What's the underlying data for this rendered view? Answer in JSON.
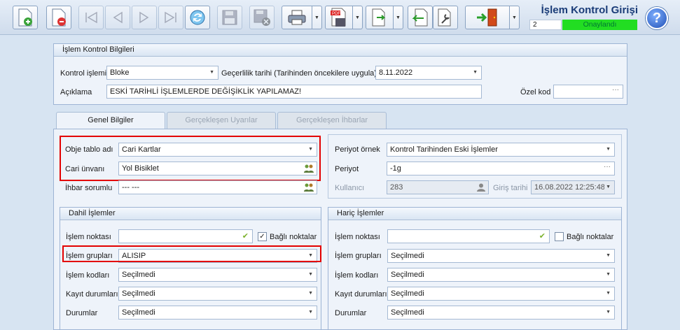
{
  "window": {
    "title": "İşlem Kontrol Girişi",
    "status_number": "2",
    "status_text": "Onaylandı"
  },
  "colors": {
    "status_ok": "#22dd22",
    "highlight": "#e30000",
    "title": "#1a3c78"
  },
  "toolbar": [
    {
      "name": "new-icon",
      "enabled": true
    },
    {
      "name": "delete-icon",
      "enabled": true
    },
    {
      "name": "first-icon",
      "enabled": false
    },
    {
      "name": "prev-icon",
      "enabled": false
    },
    {
      "name": "next-icon",
      "enabled": false
    },
    {
      "name": "last-icon",
      "enabled": false
    },
    {
      "name": "refresh-icon",
      "enabled": true
    },
    {
      "name": "save-icon",
      "enabled": false
    },
    {
      "name": "save-close-icon",
      "enabled": false
    },
    {
      "name": "print-icon",
      "enabled": true
    },
    {
      "name": "pdf-icon",
      "enabled": true
    },
    {
      "name": "export-icon",
      "enabled": true
    },
    {
      "name": "import-icon",
      "enabled": true
    },
    {
      "name": "tools-icon",
      "enabled": true
    },
    {
      "name": "exit-icon",
      "enabled": true
    }
  ],
  "info": {
    "header": "İşlem Kontrol Bilgileri",
    "control_label": "Kontrol işlemi",
    "control_value": "Bloke",
    "validity_label": "Geçerlilik tarihi (Tarihinden öncekilere uygula)",
    "validity_value": "8.11.2022",
    "desc_label": "Açıklama",
    "desc_value": "ESKİ TARİHLİ İŞLEMLERDE DEĞİŞİKLİK YAPILAMAZ!",
    "code_label": "Özel kod",
    "code_value": ""
  },
  "tabs": [
    {
      "label": "Genel Bilgiler",
      "active": true
    },
    {
      "label": "Gerçekleşen Uyarılar",
      "active": false
    },
    {
      "label": "Gerçekleşen İhbarlar",
      "active": false
    }
  ],
  "general": {
    "obj_label": "Obje tablo adı",
    "obj_value": "Cari Kartlar",
    "cari_label": "Cari ünvanı",
    "cari_value": "Yol Bisiklet",
    "ihbar_label": "İhbar sorumlu",
    "ihbar_value": "--- ---",
    "period_ex_label": "Periyot örnek",
    "period_ex_value": "Kontrol Tarihinden Eski İşlemler",
    "period_label": "Periyot",
    "period_value": "-1g",
    "user_label": "Kullanıcı",
    "user_value": "283",
    "entry_label": "Giriş tarihi",
    "entry_value": "16.08.2022 12:25:48"
  },
  "included": {
    "header": "Dahil İşlemler",
    "point_label": "İşlem noktası",
    "point_value": "",
    "linked_label": "Bağlı noktalar",
    "linked_checked": true,
    "groups_label": "İşlem grupları",
    "groups_value": "ALISIP",
    "codes_label": "İşlem kodları",
    "codes_value": "Seçilmedi",
    "record_label": "Kayıt durumları",
    "record_value": "Seçilmedi",
    "status_label": "Durumlar",
    "status_value": "Seçilmedi"
  },
  "excluded": {
    "header": "Hariç İşlemler",
    "point_label": "İşlem noktası",
    "point_value": "",
    "linked_label": "Bağlı noktalar",
    "linked_checked": false,
    "groups_label": "İşlem grupları",
    "groups_value": "Seçilmedi",
    "codes_label": "İşlem kodları",
    "codes_value": "Seçilmedi",
    "record_label": "Kayıt durumları",
    "record_value": "Seçilmedi",
    "status_label": "Durumlar",
    "status_value": "Seçilmedi"
  }
}
